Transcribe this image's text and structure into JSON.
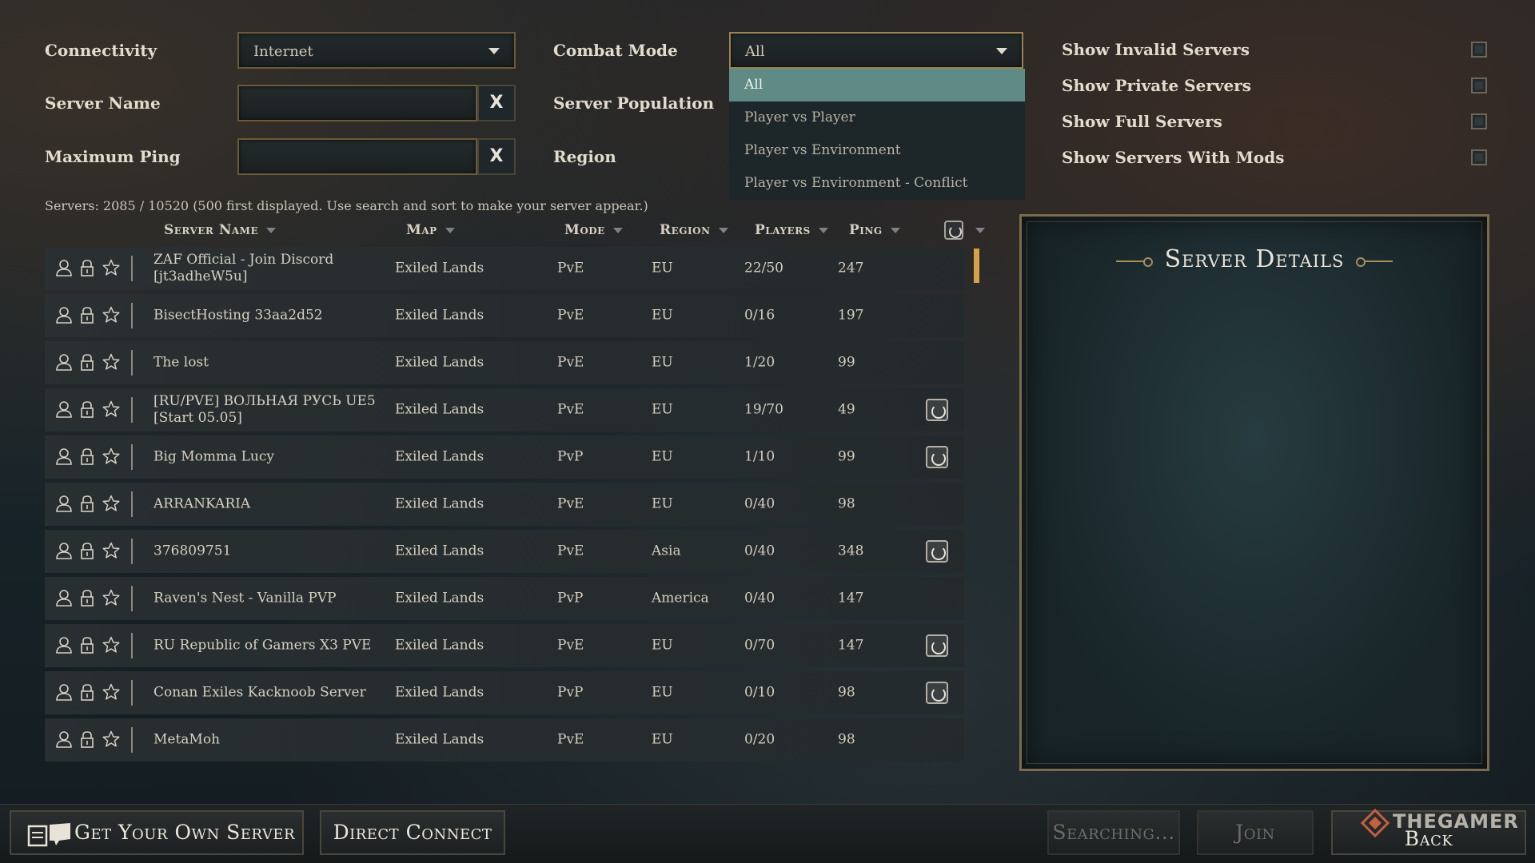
{
  "filters": {
    "connectivity_label": "Connectivity",
    "connectivity_value": "Internet",
    "server_name_label": "Server Name",
    "server_name_value": "",
    "max_ping_label": "Maximum Ping",
    "max_ping_value": "",
    "clear_label": "X",
    "combat_mode_label": "Combat Mode",
    "combat_mode_value": "All",
    "server_population_label": "Server Population",
    "region_label": "Region"
  },
  "combat_mode_options": [
    "All",
    "Player vs Player",
    "Player vs Environment",
    "Player vs Environment - Conflict"
  ],
  "checkboxes": [
    {
      "label": "Show Invalid Servers",
      "checked": false
    },
    {
      "label": "Show Private Servers",
      "checked": false
    },
    {
      "label": "Show Full Servers",
      "checked": false
    },
    {
      "label": "Show Servers With Mods",
      "checked": false
    }
  ],
  "server_count": "Servers: 2085 / 10520 (500 first displayed. Use search and sort to make your server appear.)",
  "columns": {
    "name": "Server Name",
    "map": "Map",
    "mode": "Mode",
    "region": "Region",
    "players": "Players",
    "ping": "Ping"
  },
  "servers": [
    {
      "name": "ZAF Official - Join Discord [jt3adheW5u]",
      "map": "Exiled Lands",
      "mode": "PvE",
      "region": "EU",
      "players": "22/50",
      "ping": "247",
      "mods": false
    },
    {
      "name": "BisectHosting 33aa2d52",
      "map": "Exiled Lands",
      "mode": "PvE",
      "region": "EU",
      "players": "0/16",
      "ping": "197",
      "mods": false
    },
    {
      "name": "The lost",
      "map": "Exiled Lands",
      "mode": "PvE",
      "region": "EU",
      "players": "1/20",
      "ping": "99",
      "mods": false
    },
    {
      "name": "[RU/PVE] ВОЛЬНАЯ РУСЬ UE5 [Start 05.05]",
      "map": "Exiled Lands",
      "mode": "PvE",
      "region": "EU",
      "players": "19/70",
      "ping": "49",
      "mods": true
    },
    {
      "name": "Big Momma Lucy",
      "map": "Exiled Lands",
      "mode": "PvP",
      "region": "EU",
      "players": "1/10",
      "ping": "99",
      "mods": true
    },
    {
      "name": "ARRANKARIA",
      "map": "Exiled Lands",
      "mode": "PvE",
      "region": "EU",
      "players": "0/40",
      "ping": "98",
      "mods": false
    },
    {
      "name": "376809751",
      "map": "Exiled Lands",
      "mode": "PvE",
      "region": "Asia",
      "players": "0/40",
      "ping": "348",
      "mods": true
    },
    {
      "name": "Raven's Nest - Vanilla PVP",
      "map": "Exiled Lands",
      "mode": "PvP",
      "region": "America",
      "players": "0/40",
      "ping": "147",
      "mods": false
    },
    {
      "name": "RU Republic of Gamers  X3 PVE",
      "map": "Exiled Lands",
      "mode": "PvE",
      "region": "EU",
      "players": "0/70",
      "ping": "147",
      "mods": true
    },
    {
      "name": "Conan Exiles Kacknoob Server",
      "map": "Exiled Lands",
      "mode": "PvP",
      "region": "EU",
      "players": "0/10",
      "ping": "98",
      "mods": true
    },
    {
      "name": "MetaMoh",
      "map": "Exiled Lands",
      "mode": "PvE",
      "region": "EU",
      "players": "0/20",
      "ping": "98",
      "mods": false
    }
  ],
  "details": {
    "title": "Server Details"
  },
  "bottom": {
    "get_server": "Get Your Own Server",
    "direct_connect": "Direct Connect",
    "searching": "Searching...",
    "join": "Join",
    "back": "Back"
  },
  "watermark": "THEGAMER",
  "icons": {
    "row_icons": [
      "player-icon",
      "lock-icon",
      "star-icon"
    ],
    "mods_icon": "mods-icon",
    "server_icon": "server-icon"
  },
  "colors": {
    "accent_gold": "#d6a247",
    "dropdown_selected": "#5f8a85",
    "border_gold": "#7a6b4a"
  }
}
